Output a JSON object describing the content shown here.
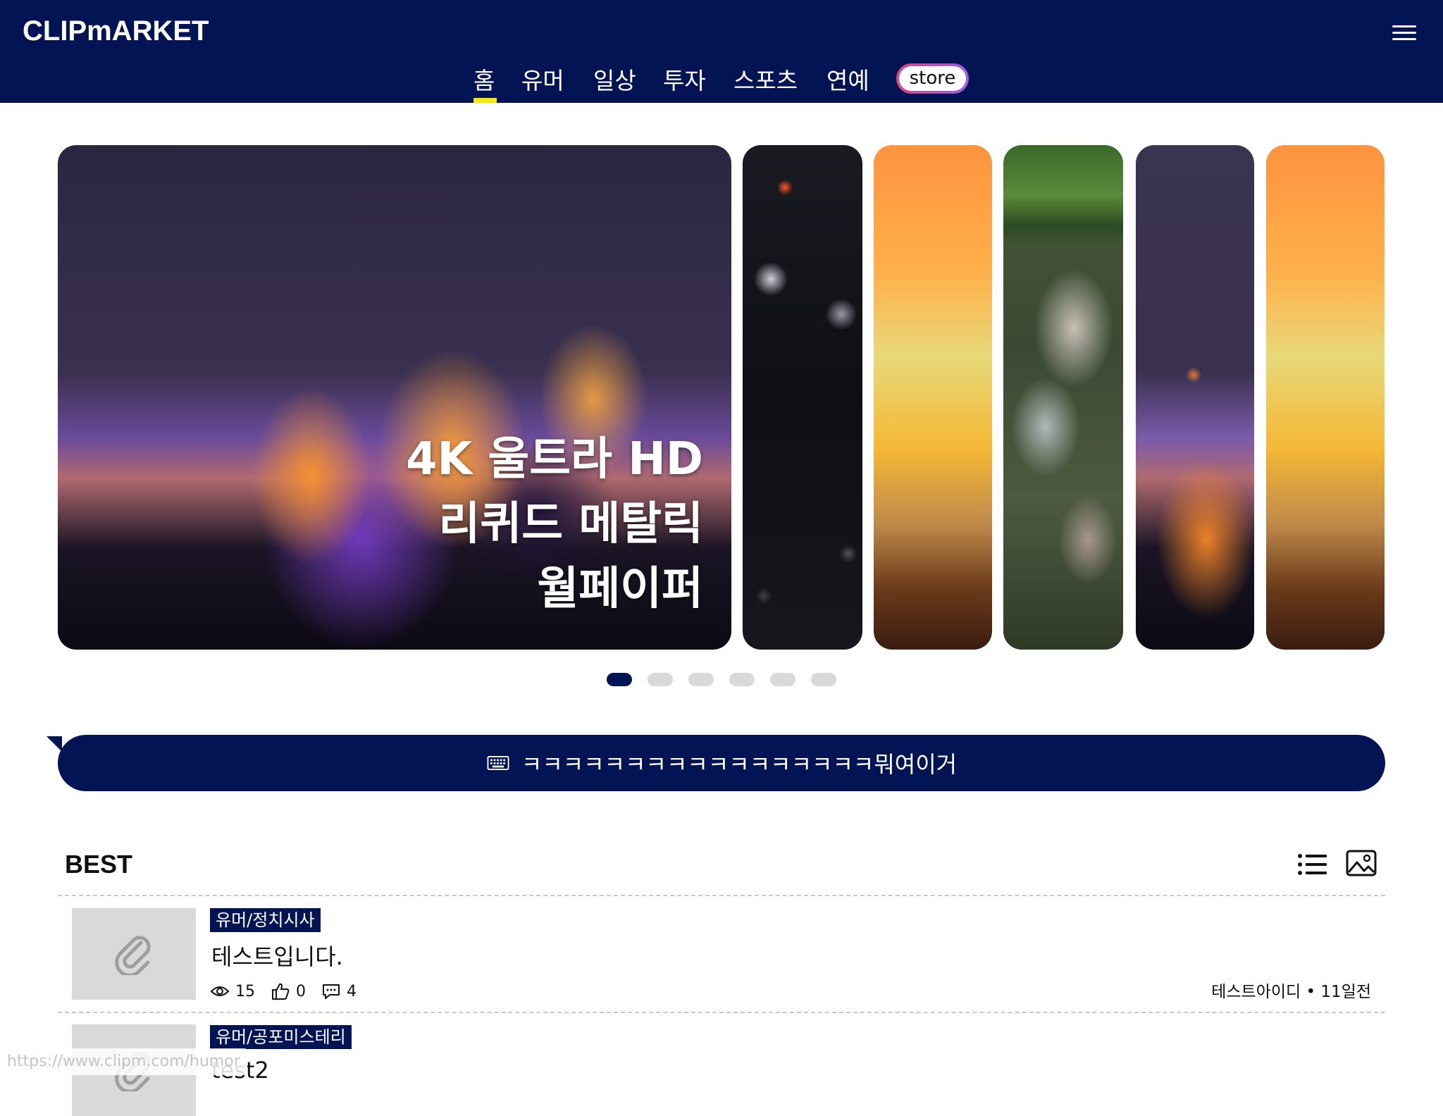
{
  "app": {
    "logo": "CLIPmARKET"
  },
  "nav": {
    "items": [
      "홈",
      "유머",
      "일상",
      "투자",
      "스포츠",
      "연예"
    ],
    "active_index": 0,
    "store_label": "store"
  },
  "carousel": {
    "main_title_lines": [
      "4K 울트라 HD",
      "리퀴드 메탈릭",
      "월페이퍼"
    ],
    "slide_count": 6,
    "active_dot": 0
  },
  "banner": {
    "text": "ㅋㅋㅋㅋㅋㅋㅋㅋㅋㅋㅋㅋㅋㅋㅋㅋㅋ뭐여이거"
  },
  "best": {
    "title": "BEST",
    "posts": [
      {
        "category": "유머/정치시사",
        "title": "테스트입니다.",
        "views": "15",
        "likes": "0",
        "comments": "4",
        "author": "테스트아이디",
        "time": "11일전"
      },
      {
        "category": "유머/공포미스테리",
        "title": "test2"
      }
    ]
  },
  "status_url": "https://www.clipm.com/humor",
  "colors": {
    "brand_navy": "#021454",
    "active_underline": "#f7ec00",
    "dot_inactive": "#d9d9d9"
  }
}
